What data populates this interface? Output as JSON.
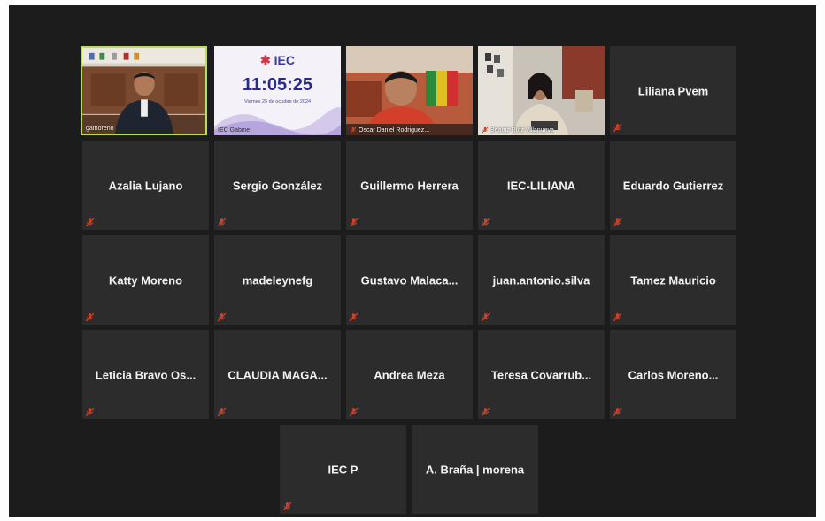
{
  "meeting": {
    "video_tiles": [
      {
        "video_label": "gamoreno",
        "muted": false,
        "active_speaker": true
      },
      {
        "video_label": "IEC Gabine",
        "muted": false,
        "active_speaker": false,
        "clock": {
          "logo_text": "IEC",
          "time": "11:05:25",
          "date": "Viernes 25 de octubre de 2024"
        }
      },
      {
        "video_label": "Oscar Daniel Rodriguez...",
        "muted": true,
        "active_speaker": false
      },
      {
        "video_label": "Beatriz Ruiz Villanueva",
        "muted": true,
        "active_speaker": false
      }
    ],
    "name_tiles": [
      "Liliana Pvem",
      "Azalia Lujano",
      "Sergio González",
      "Guillermo Herrera",
      "IEC-LILIANA",
      "Eduardo Gutierrez",
      "Katty Moreno",
      "madeleynefg",
      "Gustavo  Malaca...",
      "juan.antonio.silva",
      "Tamez Mauricio",
      "Leticia  Bravo  Os...",
      "CLAUDIA  MAGA...",
      "Andrea Meza",
      "Teresa  Covarrub...",
      "Carlos  Moreno...",
      "IEC P",
      "A. Braña | morena"
    ],
    "name_tiles_muted": [
      true,
      true,
      true,
      true,
      true,
      true,
      true,
      true,
      true,
      true,
      true,
      true,
      true,
      true,
      true,
      true,
      true,
      false
    ],
    "colors": {
      "mute_icon": "#c8412b",
      "active_border": "#b9dd5a",
      "tile_bg": "#2c2c2c"
    }
  }
}
